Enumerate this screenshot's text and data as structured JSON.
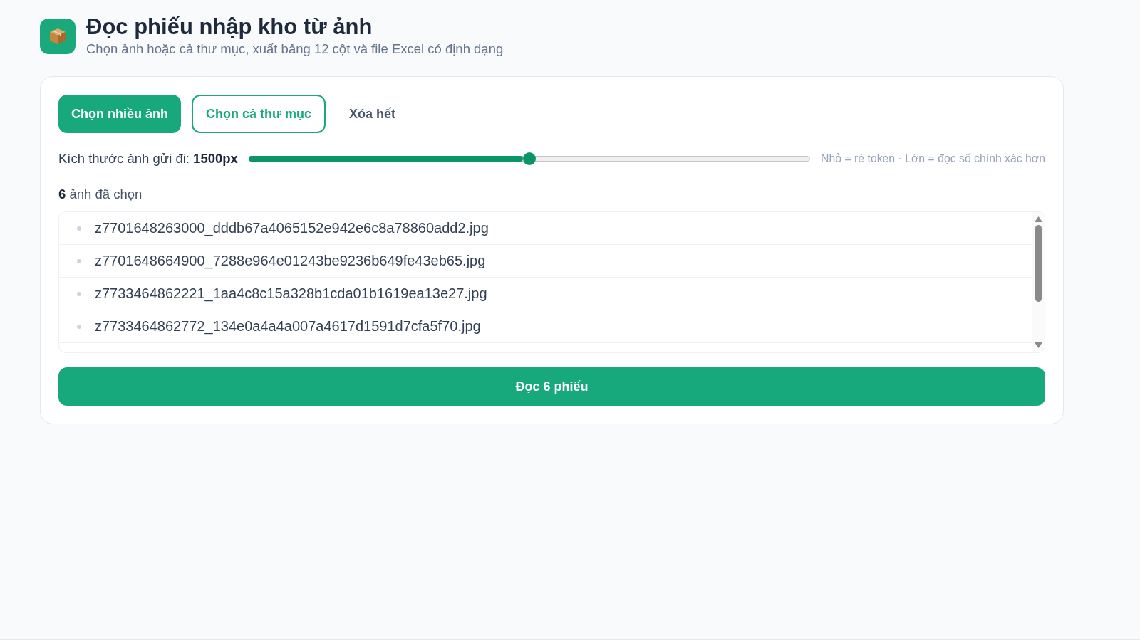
{
  "header": {
    "title": "Đọc phiếu nhập kho từ ảnh",
    "subtitle": "Chọn ảnh hoặc cả thư mục, xuất bảng 12 cột và file Excel có định dạng"
  },
  "toolbar": {
    "buttons": [
      {
        "label": "Chọn nhiều ảnh",
        "kind": "primary"
      },
      {
        "label": "Chọn cả thư mục",
        "kind": "outline"
      },
      {
        "label": "Xóa hết",
        "kind": "ghost"
      }
    ]
  },
  "slider": {
    "label": "Kích thước ảnh gửi đi: **1500px**",
    "level": 0.5,
    "hint": "Nhỏ = rẻ token · Lớn = đọc số chính xác hơn"
  },
  "file_list": {
    "count_label": "**6** ảnh đã chọn",
    "files": [
      "z7701648263000_dddb67a4065152e942e6c8a78860add2.jpg",
      "z7701648664900_7288e964e01243be9236b649fe43eb65.jpg",
      "z7733464862221_1aa4c8c15a328b1cda01b1619ea13e27.jpg",
      "z7733464862772_134e0a4a4a007a4617d1591d7cfa5f70.jpg"
    ]
  },
  "submit_button": {
    "label": "Đọc 6 phiếu"
  }
}
